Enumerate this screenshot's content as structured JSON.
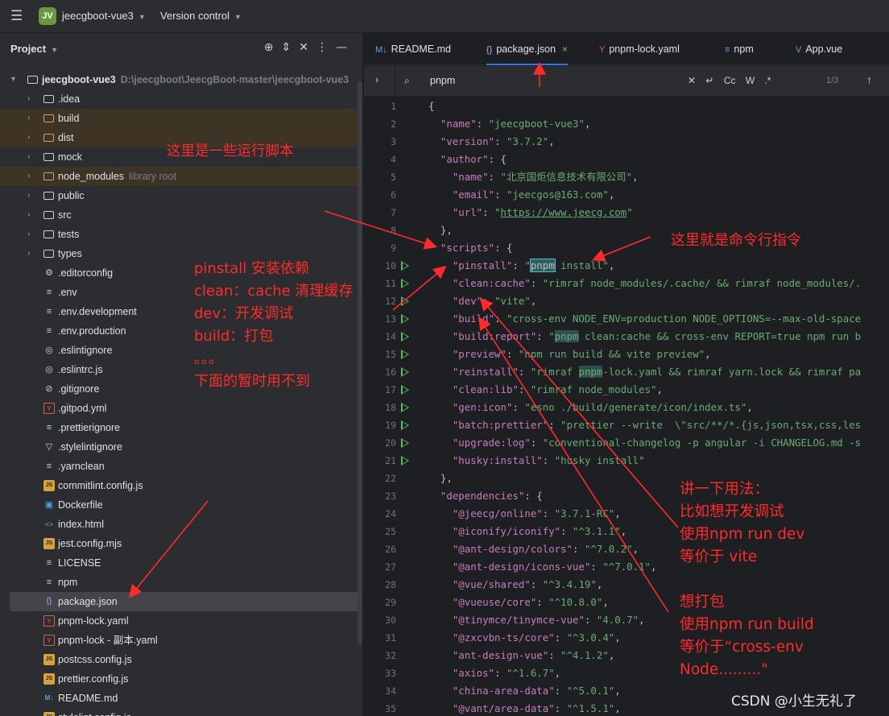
{
  "topbar": {
    "badge": "JV",
    "project": "jeecgboot-vue3",
    "vcs": "Version control"
  },
  "panel": {
    "title": "Project"
  },
  "tree": [
    {
      "name": "jeecgboot-vue3",
      "hint": "D:\\jeecgboot\\JeecgBoot-master\\jeecgboot-vue3",
      "type": "root",
      "level": 0,
      "open": true
    },
    {
      "name": ".idea",
      "type": "folder",
      "level": 1
    },
    {
      "name": "build",
      "type": "folder-excluded",
      "level": 1
    },
    {
      "name": "dist",
      "type": "folder-excluded",
      "level": 1
    },
    {
      "name": "mock",
      "type": "folder",
      "level": 1
    },
    {
      "name": "node_modules",
      "hint": "library root",
      "type": "folder-excluded",
      "level": 1
    },
    {
      "name": "public",
      "type": "folder",
      "level": 1
    },
    {
      "name": "src",
      "type": "folder",
      "level": 1
    },
    {
      "name": "tests",
      "type": "folder",
      "level": 1
    },
    {
      "name": "types",
      "type": "folder",
      "level": 1
    },
    {
      "name": ".editorconfig",
      "type": "gear",
      "level": 1
    },
    {
      "name": ".env",
      "type": "text",
      "level": 1
    },
    {
      "name": ".env.development",
      "type": "text",
      "level": 1
    },
    {
      "name": ".env.production",
      "type": "text",
      "level": 1
    },
    {
      "name": ".eslintignore",
      "type": "eslint",
      "level": 1
    },
    {
      "name": ".eslintrc.js",
      "type": "eslint",
      "level": 1
    },
    {
      "name": ".gitignore",
      "type": "ignore",
      "level": 1
    },
    {
      "name": ".gitpod.yml",
      "type": "yaml",
      "level": 1
    },
    {
      "name": ".prettierignore",
      "type": "text",
      "level": 1
    },
    {
      "name": ".stylelintignore",
      "type": "stylelint",
      "level": 1
    },
    {
      "name": ".yarnclean",
      "type": "text",
      "level": 1
    },
    {
      "name": "commitlint.config.js",
      "type": "js",
      "level": 1
    },
    {
      "name": "Dockerfile",
      "type": "docker",
      "level": 1
    },
    {
      "name": "index.html",
      "type": "html",
      "level": 1
    },
    {
      "name": "jest.config.mjs",
      "type": "js",
      "level": 1
    },
    {
      "name": "LICENSE",
      "type": "text",
      "level": 1
    },
    {
      "name": "npm",
      "type": "text",
      "level": 1
    },
    {
      "name": "package.json",
      "type": "json",
      "level": 1,
      "selected": true
    },
    {
      "name": "pnpm-lock.yaml",
      "type": "yaml",
      "level": 1
    },
    {
      "name": "pnpm-lock - 副本.yaml",
      "type": "yaml",
      "level": 1
    },
    {
      "name": "postcss.config.js",
      "type": "js",
      "level": 1
    },
    {
      "name": "prettier.config.js",
      "type": "js",
      "level": 1
    },
    {
      "name": "README.md",
      "type": "md",
      "level": 1
    },
    {
      "name": "stylelint.config.js",
      "type": "js",
      "level": 1
    }
  ],
  "tabs": [
    {
      "label": "README.md",
      "icon": "M↓"
    },
    {
      "label": "package.json",
      "icon": "{}",
      "active": true
    },
    {
      "label": "pnpm-lock.yaml",
      "icon": "Y"
    },
    {
      "label": "npm",
      "icon": "≡"
    },
    {
      "label": "App.vue",
      "icon": "V"
    }
  ],
  "search": {
    "query": "pnpm",
    "options": "Cc W .*",
    "count": "1/3"
  },
  "code_lines": [
    {
      "n": 1,
      "html": "<span class='p'>{</span>"
    },
    {
      "n": 2,
      "html": "  <span class='k'>\"name\"</span><span class='p'>: </span><span class='s'>\"jeecgboot-vue3\"</span><span class='p'>,</span>"
    },
    {
      "n": 3,
      "html": "  <span class='k'>\"version\"</span><span class='p'>: </span><span class='s'>\"3.7.2\"</span><span class='p'>,</span>"
    },
    {
      "n": 4,
      "html": "  <span class='k'>\"author\"</span><span class='p'>: {</span>"
    },
    {
      "n": 5,
      "html": "    <span class='k'>\"name\"</span><span class='p'>: </span><span class='s'>\"北京国炬信息技术有限公司\"</span><span class='p'>,</span>"
    },
    {
      "n": 6,
      "html": "    <span class='k'>\"email\"</span><span class='p'>: </span><span class='s'>\"jeecgos@163.com\"</span><span class='p'>,</span>"
    },
    {
      "n": 7,
      "html": "    <span class='k'>\"url\"</span><span class='p'>: </span><span class='s'>\"<span class='u'>https://www.jeecg.com</span>\"</span>"
    },
    {
      "n": 8,
      "html": "  <span class='p'>},</span>"
    },
    {
      "n": 9,
      "html": "  <span class='k'>\"scripts\"</span><span class='p'>: {</span>"
    },
    {
      "n": 10,
      "run": true,
      "html": "    <span class='k'>\"pinstall\"</span><span class='p'>: </span><span class='s'>\"<span class='hl'>pnpm</span> install\"</span><span class='p'>,</span>"
    },
    {
      "n": 11,
      "run": true,
      "html": "    <span class='k'>\"clean:cache\"</span><span class='p'>: </span><span class='s'>\"rimraf node_modules/.cache/ &amp;&amp; rimraf node_modules/.</span>"
    },
    {
      "n": 12,
      "run": true,
      "html": "    <span class='k'>\"dev\"</span><span class='p'>: </span><span class='s'>\"vite\"</span><span class='p'>,</span>"
    },
    {
      "n": 13,
      "run": true,
      "html": "    <span class='k'>\"build\"</span><span class='p'>: </span><span class='s'>\"cross-env NODE_ENV=production NODE_OPTIONS=--max-old-space</span>"
    },
    {
      "n": 14,
      "run": true,
      "html": "    <span class='k'>\"build:report\"</span><span class='p'>: </span><span class='s'>\"<span class='hl2'>pnpm</span> clean:cache &amp;&amp; cross-env REPORT=true npm run b</span>"
    },
    {
      "n": 15,
      "run": true,
      "html": "    <span class='k'>\"preview\"</span><span class='p'>: </span><span class='s'>\"npm run build &amp;&amp; vite preview\"</span><span class='p'>,</span>"
    },
    {
      "n": 16,
      "run": true,
      "html": "    <span class='k'>\"reinstall\"</span><span class='p'>: </span><span class='s'>\"rimraf <span class='hl2'>pnpm</span>-lock.yaml &amp;&amp; rimraf yarn.lock &amp;&amp; rimraf pa</span>"
    },
    {
      "n": 17,
      "run": true,
      "html": "    <span class='k'>\"clean:lib\"</span><span class='p'>: </span><span class='s'>\"rimraf node_modules\"</span><span class='p'>,</span>"
    },
    {
      "n": 18,
      "run": true,
      "html": "    <span class='k'>\"gen:icon\"</span><span class='p'>: </span><span class='s'>\"esno ./build/generate/icon/index.ts\"</span><span class='p'>,</span>"
    },
    {
      "n": 19,
      "run": true,
      "html": "    <span class='k'>\"batch:prettier\"</span><span class='p'>: </span><span class='s'>\"prettier --write  \\\"src/**/*.{js,json,tsx,css,les</span>"
    },
    {
      "n": 20,
      "run": true,
      "html": "    <span class='k'>\"upgrade:log\"</span><span class='p'>: </span><span class='s'>\"conventional-changelog -p angular -i CHANGELOG.md -s</span>"
    },
    {
      "n": 21,
      "run": true,
      "html": "    <span class='k'>\"husky:install\"</span><span class='p'>: </span><span class='s'>\"husky install\"</span>"
    },
    {
      "n": 22,
      "html": "  <span class='p'>},</span>"
    },
    {
      "n": 23,
      "html": "  <span class='k'>\"dependencies\"</span><span class='p'>: {</span>"
    },
    {
      "n": 24,
      "html": "    <span class='k'>\"@jeecg/online\"</span><span class='p'>: </span><span class='s'>\"3.7.1-RC\"</span><span class='p'>,</span>"
    },
    {
      "n": 25,
      "html": "    <span class='k'>\"@iconify/iconify\"</span><span class='p'>: </span><span class='s'>\"^3.1.1\"</span><span class='p'>,</span>"
    },
    {
      "n": 26,
      "html": "    <span class='k'>\"@ant-design/colors\"</span><span class='p'>: </span><span class='s'>\"^7.0.2\"</span><span class='p'>,</span>"
    },
    {
      "n": 27,
      "html": "    <span class='k'>\"@ant-design/icons-vue\"</span><span class='p'>: </span><span class='s'>\"^7.0.1\"</span><span class='p'>,</span>"
    },
    {
      "n": 28,
      "html": "    <span class='k'>\"@vue/shared\"</span><span class='p'>: </span><span class='s'>\"^3.4.19\"</span><span class='p'>,</span>"
    },
    {
      "n": 29,
      "html": "    <span class='k'>\"@vueuse/core\"</span><span class='p'>: </span><span class='s'>\"^10.8.0\"</span><span class='p'>,</span>"
    },
    {
      "n": 30,
      "html": "    <span class='k'>\"@tinymce/tinymce-vue\"</span><span class='p'>: </span><span class='s'>\"4.0.7\"</span><span class='p'>,</span>"
    },
    {
      "n": 31,
      "html": "    <span class='k'>\"@zxcvbn-ts/core\"</span><span class='p'>: </span><span class='s'>\"^3.0.4\"</span><span class='p'>,</span>"
    },
    {
      "n": 32,
      "html": "    <span class='k'>\"ant-design-vue\"</span><span class='p'>: </span><span class='s'>\"^4.1.2\"</span><span class='p'>,</span>"
    },
    {
      "n": 33,
      "html": "    <span class='k'>\"axios\"</span><span class='p'>: </span><span class='s'>\"^1.6.7\"</span><span class='p'>,</span>"
    },
    {
      "n": 34,
      "html": "    <span class='k'>\"china-area-data\"</span><span class='p'>: </span><span class='s'>\"^5.0.1\"</span><span class='p'>,</span>"
    },
    {
      "n": 35,
      "html": "    <span class='k'>\"@vant/area-data\"</span><span class='p'>: </span><span class='s'>\"^1.5.1\"</span><span class='p'>,</span>"
    }
  ],
  "annotations": {
    "scripts_note": "这里是一些运行脚本",
    "list_note": "pinstall 安装依赖\nclean：cache 清理缓存\ndev：开发调试\nbuild：打包\n。。。\n下面的暂时用不到",
    "cmd_note": "这里就是命令行指令",
    "usage_note": "讲一下用法：\n比如想开发调试\n使用npm run dev\n等价于 vite\n\n想打包\n使用npm run build\n等价于“cross-env\nNode.........\""
  },
  "watermark": "CSDN @小生无礼了",
  "colors": {
    "accent": "#3574f0",
    "annotation": "#ff2b2b",
    "run": "#5fb865"
  }
}
